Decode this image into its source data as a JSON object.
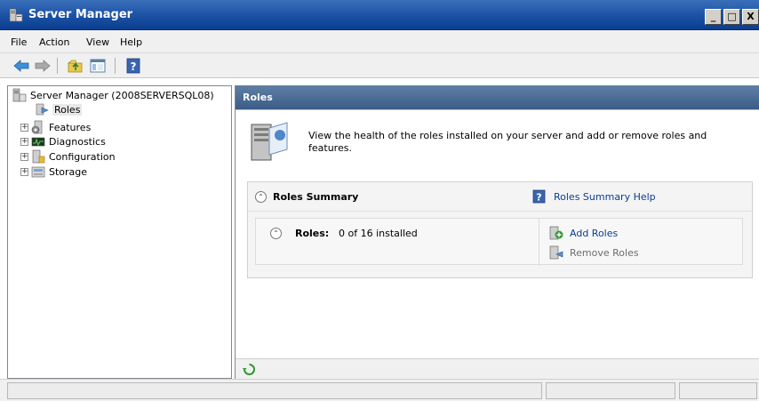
{
  "window": {
    "title": "Server Manager",
    "controls": {
      "minimize": "_",
      "maximize": "□",
      "close": "X"
    }
  },
  "menu": [
    "File",
    "Action",
    "View",
    "Help"
  ],
  "toolbar": {
    "buttons": [
      "back-arrow-icon",
      "forward-arrow-icon",
      "up-folder-icon",
      "show-hide-tree-icon",
      "help-icon"
    ]
  },
  "tree": {
    "root": "Server Manager (2008SERVERSQL08)",
    "items": [
      {
        "label": "Roles",
        "selected": true,
        "expandable": false
      },
      {
        "label": "Features",
        "selected": false,
        "expandable": true
      },
      {
        "label": "Diagnostics",
        "selected": false,
        "expandable": true
      },
      {
        "label": "Configuration",
        "selected": false,
        "expandable": true
      },
      {
        "label": "Storage",
        "selected": false,
        "expandable": true
      }
    ],
    "expander_symbol": "+"
  },
  "content": {
    "header": "Roles",
    "description": "View the health of the roles installed on your server and add or remove roles and features.",
    "summary": {
      "title": "Roles Summary",
      "help_link": "Roles Summary Help",
      "collapse_symbol": "⌃",
      "roles_label": "Roles:",
      "roles_count": "0 of 16 installed",
      "add_roles": "Add Roles",
      "remove_roles": "Remove Roles"
    }
  },
  "colors": {
    "title_bar": "#1f56a8",
    "content_header": "#3b5c86",
    "link": "#0b3d91",
    "disabled_link": "#6d6d6d"
  }
}
